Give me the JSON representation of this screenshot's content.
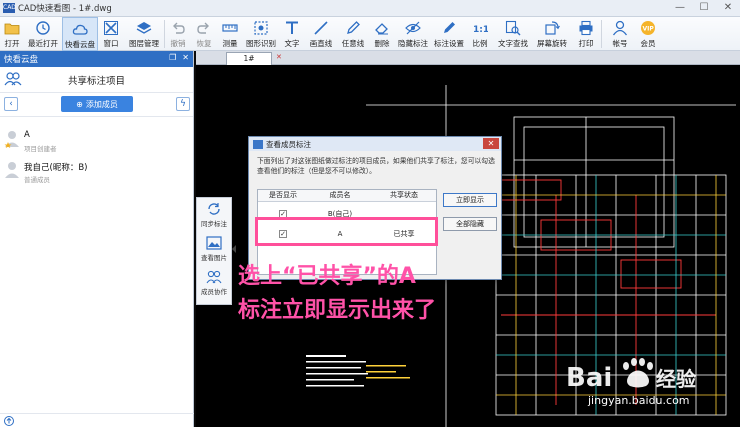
{
  "window": {
    "title": "CAD快速看图 - 1#.dwg",
    "logo": "CAD"
  },
  "toolbar": [
    {
      "label": "打开",
      "icon": "folder-icon",
      "state": "normal"
    },
    {
      "label": "最近打开",
      "icon": "history-icon",
      "state": "normal"
    },
    {
      "label": "快看云盘",
      "icon": "cloud-icon",
      "state": "active"
    },
    {
      "label": "窗口",
      "icon": "window-icon",
      "state": "normal"
    },
    {
      "label": "图层管理",
      "icon": "layers-icon",
      "state": "normal"
    },
    {
      "label": "撤销",
      "icon": "undo-icon",
      "state": "disabled"
    },
    {
      "label": "恢复",
      "icon": "redo-icon",
      "state": "disabled"
    },
    {
      "label": "测量",
      "icon": "ruler-icon",
      "state": "normal"
    },
    {
      "label": "图形识别",
      "icon": "recognize-icon",
      "state": "normal"
    },
    {
      "label": "文字",
      "icon": "text-icon",
      "state": "normal"
    },
    {
      "label": "画直线",
      "icon": "line-icon",
      "state": "normal"
    },
    {
      "label": "任意线",
      "icon": "pencil-icon",
      "state": "normal"
    },
    {
      "label": "删除",
      "icon": "eraser-icon",
      "state": "normal"
    },
    {
      "label": "隐藏标注",
      "icon": "hide-annotation-icon",
      "state": "normal"
    },
    {
      "label": "标注设置",
      "icon": "annotation-settings-icon",
      "state": "normal"
    },
    {
      "label": "比例",
      "icon": "scale-icon",
      "state": "normal"
    },
    {
      "label": "文字查找",
      "icon": "find-text-icon",
      "state": "normal"
    },
    {
      "label": "屏幕旋转",
      "icon": "rotate-icon",
      "state": "normal"
    },
    {
      "label": "打印",
      "icon": "print-icon",
      "state": "normal"
    },
    {
      "label": "帐号",
      "icon": "user-icon",
      "state": "normal"
    },
    {
      "label": "会员",
      "icon": "vip-icon",
      "state": "normal"
    }
  ],
  "leftpanel": {
    "title": "快看云盘",
    "project": "共享标注项目",
    "add_member": "添加成员",
    "members": [
      {
        "name": "A",
        "role": "项目创建者"
      },
      {
        "name": "我自己(昵称：B)",
        "role": "普通成员"
      }
    ]
  },
  "sidepanel": [
    {
      "label": "同步标注",
      "icon": "sync-icon"
    },
    {
      "label": "查看图片",
      "icon": "image-icon"
    },
    {
      "label": "成员协作",
      "icon": "members-icon"
    }
  ],
  "doc_tab": "1#",
  "dialog": {
    "title": "查看成员标注",
    "description": "下面列出了对这张图纸做过标注的项目成员，如果他们共享了标注，您可以勾选查看他们的标注（但是您不可以修改）。",
    "columns": [
      "是否显示",
      "成员名",
      "共享状态"
    ],
    "rows": [
      {
        "checked": "✓",
        "name": "B(自己)",
        "status": ""
      },
      {
        "checked": "✓",
        "name": "A",
        "status": "已共享"
      }
    ],
    "buttons": [
      "立即显示",
      "全部隐藏"
    ]
  },
  "annotation": {
    "line1": "选上“已共享”的A",
    "line2": "标注立即显示出来了"
  },
  "watermark": {
    "brand": "Bai",
    "brand2": "经验",
    "url": "jingyan.baidu.com"
  },
  "colors": {
    "accent": "#2f6fc4",
    "highlight": "#ff4f9a",
    "annotation": "#ff52a8",
    "cad_bg": "#000000"
  }
}
